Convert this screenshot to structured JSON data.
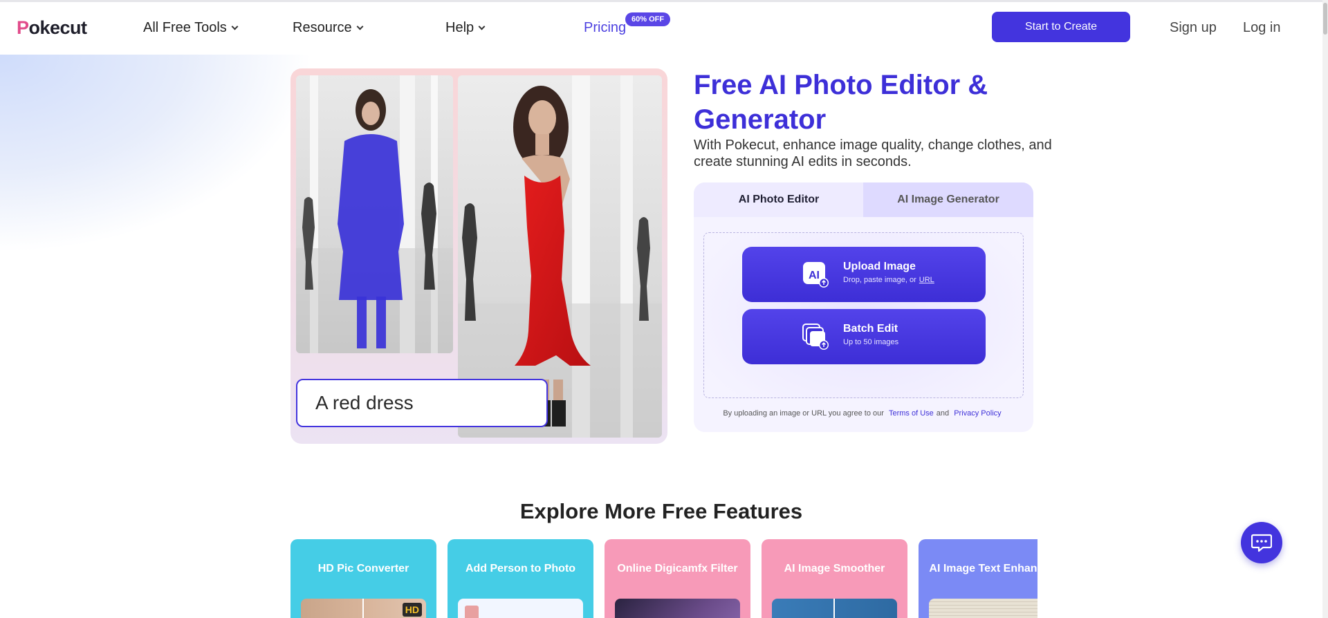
{
  "header": {
    "logo": "Pokecut",
    "nav": [
      {
        "label": "All Free Tools"
      },
      {
        "label": "Resource"
      },
      {
        "label": "Help"
      },
      {
        "label": "Pricing"
      }
    ],
    "pricing_badge": "60% OFF",
    "cta_label": "Start to Create",
    "signup_label": "Sign up",
    "login_label": "Log in"
  },
  "demo": {
    "prompt_text": "A red dress"
  },
  "hero": {
    "title": "Free AI Photo Editor & Generator",
    "subtitle": "With Pokecut, enhance image quality, change clothes, and create stunning AI edits in seconds."
  },
  "editor": {
    "tabs": [
      {
        "label": "AI Photo Editor",
        "active": true
      },
      {
        "label": "AI Image Generator",
        "active": false
      }
    ],
    "upload": {
      "title": "Upload Image",
      "subtitle": "Drop, paste image, or",
      "url_label": "URL",
      "icon": "ai-upload-icon"
    },
    "batch": {
      "title": "Batch Edit",
      "subtitle": "Up to 50 images",
      "icon": "batch-upload-icon"
    },
    "legal": {
      "text": "By uploading an image or URL you agree to our",
      "terms": "Terms of Use",
      "and": "and",
      "privacy": "Privacy Policy"
    }
  },
  "features": {
    "title": "Explore More Free Features",
    "cards": [
      {
        "label": "HD Pic Converter",
        "badge": "HD",
        "color": "#45cde6"
      },
      {
        "label": "Add Person to Photo",
        "color": "#45cde6"
      },
      {
        "label": "Online Digicamfx Filter",
        "color": "#f79ab8"
      },
      {
        "label": "AI Image Smoother",
        "color": "#f79ab8"
      },
      {
        "label": "AI Image Text Enhancer",
        "color": "#7b8af5"
      }
    ]
  },
  "chat": {
    "icon": "chat-icon"
  },
  "colors": {
    "accent": "#4334de",
    "title": "#3d2fd8"
  }
}
